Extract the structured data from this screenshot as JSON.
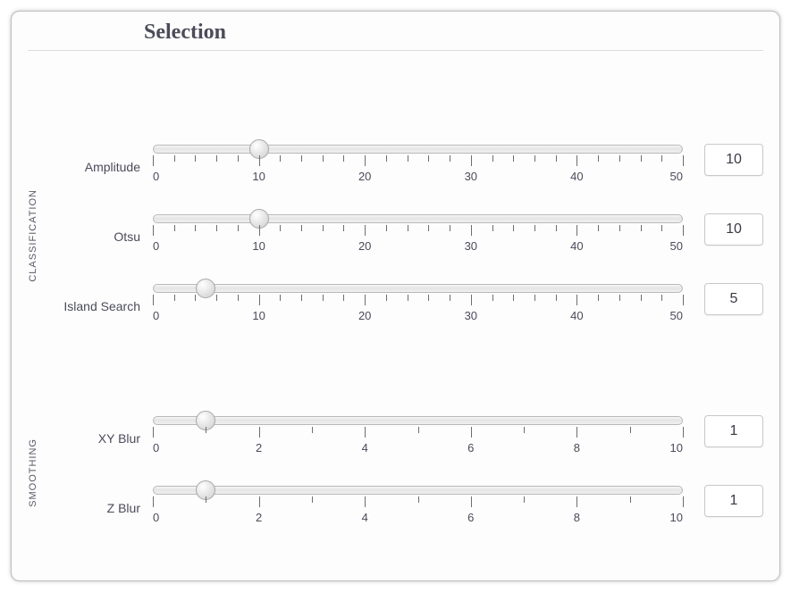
{
  "title": "Selection",
  "sections": [
    {
      "label": "CLASSIFICATION",
      "rows": [
        {
          "label": "Amplitude",
          "min": 0,
          "max": 50,
          "majors": [
            0,
            10,
            20,
            30,
            40,
            50
          ],
          "minorStep": 2,
          "value": 10
        },
        {
          "label": "Otsu",
          "min": 0,
          "max": 50,
          "majors": [
            0,
            10,
            20,
            30,
            40,
            50
          ],
          "minorStep": 2,
          "value": 10
        },
        {
          "label": "Island Search",
          "min": 0,
          "max": 50,
          "majors": [
            0,
            10,
            20,
            30,
            40,
            50
          ],
          "minorStep": 2,
          "value": 5
        }
      ]
    },
    {
      "label": "SMOOTHING",
      "rows": [
        {
          "label": "XY Blur",
          "min": 0,
          "max": 10,
          "majors": [
            0,
            2,
            4,
            6,
            8,
            10
          ],
          "minorStep": 1,
          "value": 1
        },
        {
          "label": "Z Blur",
          "min": 0,
          "max": 10,
          "majors": [
            0,
            2,
            4,
            6,
            8,
            10
          ],
          "minorStep": 1,
          "value": 1
        }
      ]
    }
  ]
}
